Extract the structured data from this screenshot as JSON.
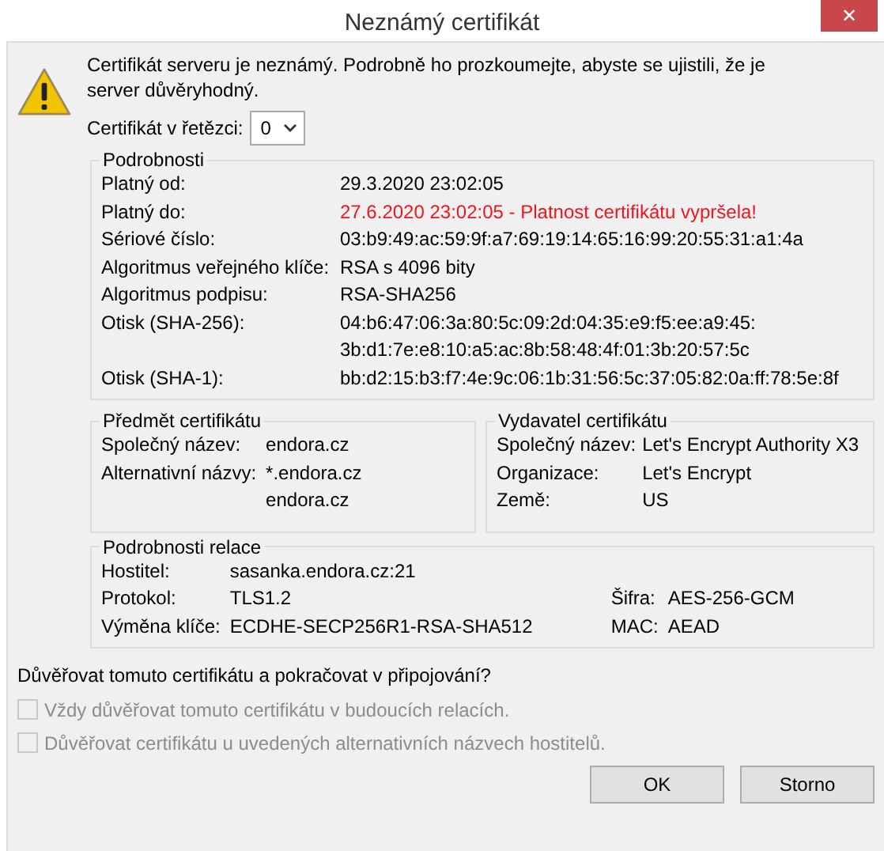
{
  "window": {
    "title": "Neznámý certifikát",
    "close": "✕"
  },
  "message": "Certifikát serveru je neznámý. Podrobně ho prozkoumejte, abyste se ujistili, že je server důvěryhodný.",
  "chain": {
    "label": "Certifikát v řetězci:",
    "value": "0"
  },
  "details": {
    "title": "Podrobnosti",
    "rows": [
      {
        "label": "Platný od:",
        "values": [
          "29.3.2020 23:02:05"
        ],
        "expired": false
      },
      {
        "label": "Platný do:",
        "values": [
          "27.6.2020 23:02:05 - Platnost certifikátu vypršela!"
        ],
        "expired": true
      },
      {
        "label": "Sériové číslo:",
        "values": [
          "03:b9:49:ac:59:9f:a7:69:19:14:65:16:99:20:55:31:a1:4a"
        ],
        "expired": false
      },
      {
        "label": "Algoritmus veřejného klíče:",
        "values": [
          "RSA s 4096 bity"
        ],
        "expired": false
      },
      {
        "label": "Algoritmus podpisu:",
        "values": [
          "RSA-SHA256"
        ],
        "expired": false
      },
      {
        "label": "Otisk (SHA-256):",
        "values": [
          "04:b6:47:06:3a:80:5c:09:2d:04:35:e9:f5:ee:a9:45:",
          "3b:d1:7e:e8:10:a5:ac:8b:58:48:4f:01:3b:20:57:5c"
        ],
        "expired": false
      },
      {
        "label": "Otisk (SHA-1):",
        "values": [
          "bb:d2:15:b3:f7:4e:9c:06:1b:31:56:5c:37:05:82:0a:ff:78:5e:8f"
        ],
        "expired": false
      }
    ]
  },
  "subject": {
    "title": "Předmět certifikátu",
    "rows": [
      {
        "label": "Společný název:",
        "values": [
          "endora.cz"
        ]
      },
      {
        "label": "Alternativní názvy:",
        "values": [
          "*.endora.cz",
          "endora.cz"
        ]
      }
    ]
  },
  "issuer": {
    "title": "Vydavatel certifikátu",
    "rows": [
      {
        "label": "Společný název:",
        "values": [
          "Let's Encrypt Authority X3"
        ]
      },
      {
        "label": "Organizace:",
        "values": [
          "Let's Encrypt"
        ]
      },
      {
        "label": "Země:",
        "values": [
          "US"
        ]
      }
    ]
  },
  "session": {
    "title": "Podrobnosti relace",
    "rows": [
      {
        "cells": [
          {
            "label": "Hostitel:",
            "value": "sasanka.endora.cz:21"
          }
        ]
      },
      {
        "cells": [
          {
            "label": "Protokol:",
            "value": "TLS1.2"
          },
          {
            "label": "Šifra:",
            "value": "AES-256-GCM"
          }
        ]
      },
      {
        "cells": [
          {
            "label": "Výměna klíče:",
            "value": "ECDHE-SECP256R1-RSA-SHA512"
          },
          {
            "label": "MAC:",
            "value": "AEAD"
          }
        ]
      }
    ]
  },
  "question": "Důvěřovat tomuto certifikátu a pokračovat v připojování?",
  "options": [
    {
      "label": "Vždy důvěřovat tomuto certifikátu v budoucích relacích.",
      "checked": false,
      "disabled": true
    },
    {
      "label": "Důvěřovat certifikátu u uvedených alternativních názvech hostitelů.",
      "checked": false,
      "disabled": true
    }
  ],
  "buttons": [
    "OK",
    "Storno"
  ]
}
